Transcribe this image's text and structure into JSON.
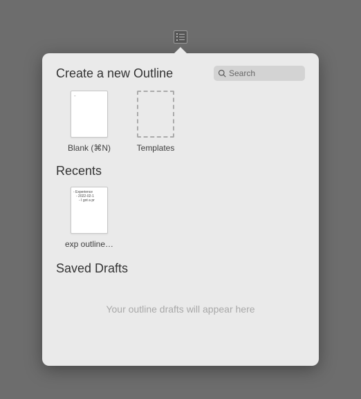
{
  "header": {
    "create_title": "Create a new Outline"
  },
  "search": {
    "placeholder": "Search",
    "value": ""
  },
  "create_items": {
    "blank_label": "Blank (⌘N)",
    "templates_label": "Templates"
  },
  "recents": {
    "title": "Recents",
    "items": [
      {
        "label": "exp outline…",
        "preview": {
          "line1": "- Experience",
          "line2": "- 2022-02-1",
          "line3": "- I got a pr"
        }
      }
    ]
  },
  "saved_drafts": {
    "title": "Saved Drafts",
    "empty_message": "Your outline drafts will appear here"
  }
}
